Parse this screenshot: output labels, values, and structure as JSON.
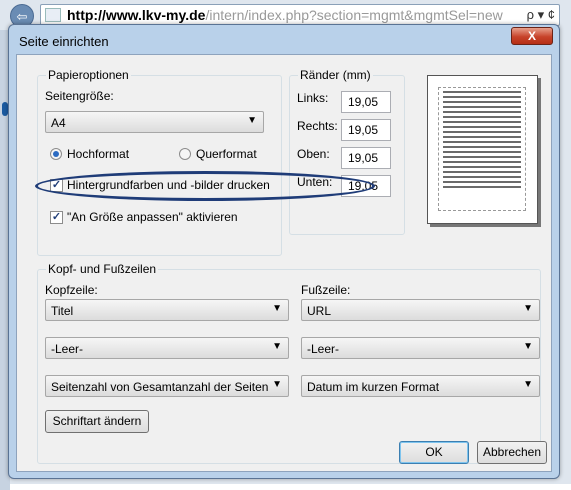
{
  "browser": {
    "address_host": "http://www.lkv-my.de",
    "address_rest": "/intern/index.php?section=mgmt&mgmtSel=new",
    "address_tools": "ρ ▾ ¢",
    "back_arrow": "⇦"
  },
  "dialog": {
    "title": "Seite einrichten",
    "close_label": "X",
    "paper_options": {
      "legend": "Papieroptionen",
      "size_label": "Seitengröße:",
      "size_value": "A4",
      "orientation": {
        "portrait_label": "Hochformat",
        "landscape_label": "Querformat",
        "selected": "portrait"
      },
      "print_background": {
        "label": "Hintergrundfarben und -bilder drucken",
        "checked": true
      },
      "shrink_to_fit": {
        "label": "\"An Größe anpassen\" aktivieren",
        "checked": true
      }
    },
    "margins": {
      "legend": "Ränder (mm)",
      "left_label": "Links:",
      "left_value": "19,05",
      "right_label": "Rechts:",
      "right_value": "19,05",
      "top_label": "Oben:",
      "top_value": "19,05",
      "bottom_label": "Unten:",
      "bottom_value": "19,05"
    },
    "header_footer": {
      "legend": "Kopf- und Fußzeilen",
      "header_label": "Kopfzeile:",
      "footer_label": "Fußzeile:",
      "header_1": "Titel",
      "header_2": "-Leer-",
      "header_3": "Seitenzahl von Gesamtanzahl der Seiten",
      "footer_1": "URL",
      "footer_2": "-Leer-",
      "footer_3": "Datum im kurzen Format",
      "font_button": "Schriftart ändern"
    },
    "ok_label": "OK",
    "cancel_label": "Abbrechen"
  },
  "icons": {
    "combo_arrow": "▼",
    "check_mark": "✓"
  },
  "colors": {
    "highlight_ellipse": "#1f3c78",
    "dialog_frame": "#b9d1ea",
    "close_button": "#c7432a"
  }
}
